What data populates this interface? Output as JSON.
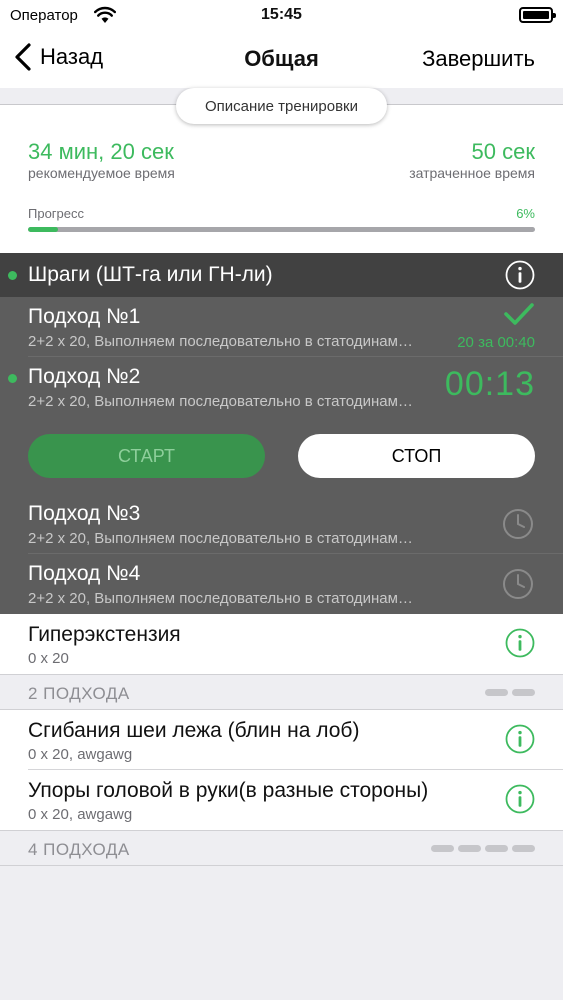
{
  "status_bar": {
    "carrier": "Оператор",
    "time": "15:45"
  },
  "navbar": {
    "back_label": "Назад",
    "title": "Общая",
    "finish_label": "Завершить"
  },
  "summary": {
    "description_button": "Описание тренировки",
    "recommended_time": "34 мин, 20 сек",
    "recommended_label": "рекомендуемое время",
    "spent_time": "50 сек",
    "spent_label": "затраченное время",
    "progress_label": "Прогресс",
    "progress_percent": "6%",
    "progress_value": 0.06
  },
  "active_exercise": {
    "name": "Шраги (ШТ-га или ГН-ли)",
    "sets": [
      {
        "title": "Подход №1",
        "desc": "2+2 х 20, Выполняем последовательно в статодинамическом режиме",
        "status": "done",
        "result": "20 за 00:40"
      },
      {
        "title": "Подход №2",
        "desc": "2+2 х 20, Выполняем последовательно в статодинамическом режиме",
        "status": "active",
        "timer": "00:13"
      },
      {
        "title": "Подход №3",
        "desc": "2+2 х 20, Выполняем последовательно в статодинамическом режиме",
        "status": "pending"
      },
      {
        "title": "Подход №4",
        "desc": "2+2 х 20, Выполняем последовательно в статодинамическом режиме",
        "status": "pending"
      }
    ],
    "start_label": "СТАРТ",
    "stop_label": "СТОП"
  },
  "exercises": [
    {
      "name": "Гиперэкстензия",
      "detail": "0 х 20"
    }
  ],
  "groups": [
    {
      "header": "2 ПОДХОДА",
      "items": [
        {
          "name": "Сгибания шеи лежа (блин на лоб)",
          "detail": "0 х 20, awgawg"
        },
        {
          "name": "Упоры головой в руки(в разные стороны)",
          "detail": "0 х 20, awgawg"
        }
      ]
    },
    {
      "header": "4 ПОДХОДА",
      "items": []
    }
  ],
  "colors": {
    "accent": "#3dba5e",
    "dark_bg": "#5d5d5d",
    "dark_header": "#414141"
  }
}
